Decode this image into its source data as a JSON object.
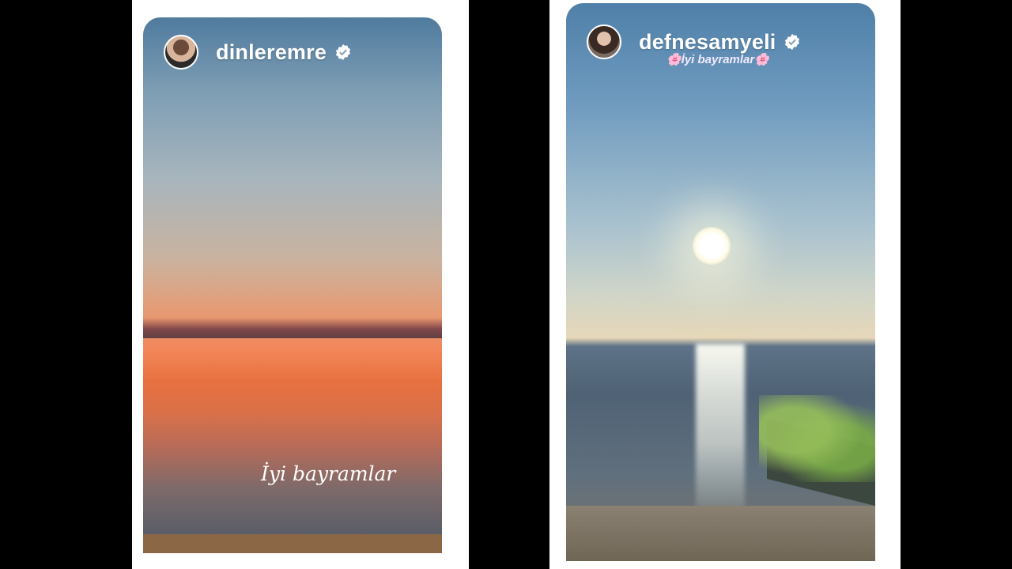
{
  "stories": [
    {
      "username": "dinleremre",
      "verified": true,
      "overlay_text": "İyi bayramlar",
      "icons": [
        "avatar",
        "verified-badge-icon"
      ]
    },
    {
      "username": "defnesamyeli",
      "verified": true,
      "overlay_text": "🌸İyi bayramlar🌸",
      "icons": [
        "avatar",
        "verified-badge-icon"
      ]
    }
  ],
  "colors": {
    "background": "#000000",
    "panel": "#ffffff",
    "text": "#ffffff"
  }
}
